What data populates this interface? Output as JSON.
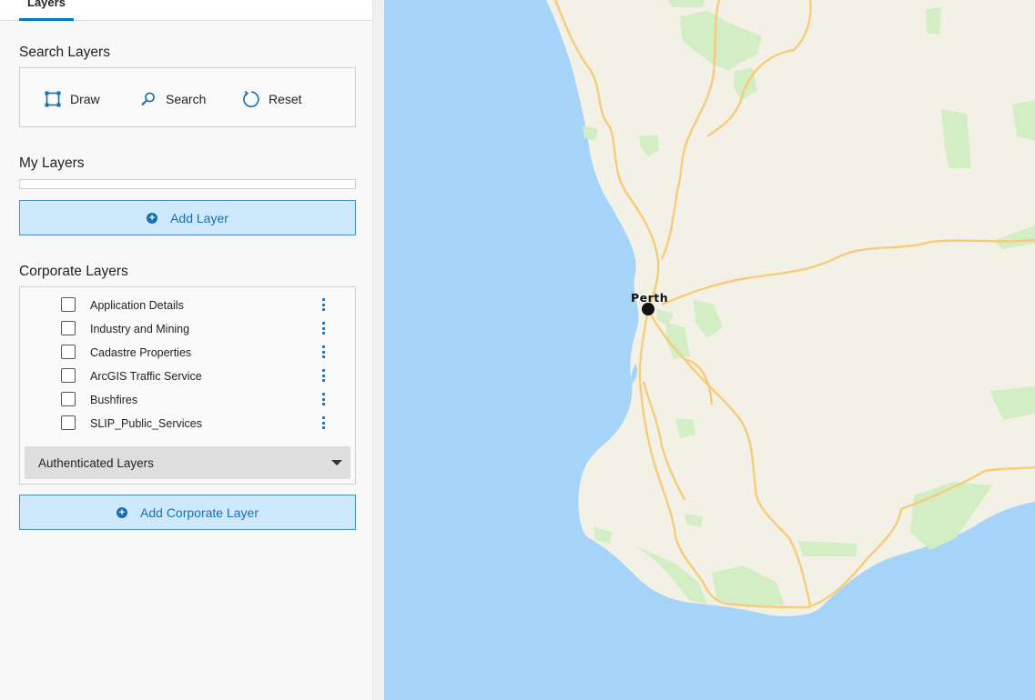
{
  "tabs": {
    "active_label": "Layers"
  },
  "search_layers": {
    "title": "Search Layers",
    "tools": [
      {
        "label": "Draw",
        "icon": "draw-rectangle-icon"
      },
      {
        "label": "Search",
        "icon": "search-icon"
      },
      {
        "label": "Reset",
        "icon": "reset-icon"
      }
    ]
  },
  "my_layers": {
    "title": "My Layers",
    "add_button_label": "Add Layer"
  },
  "corporate_layers": {
    "title": "Corporate Layers",
    "items": [
      {
        "label": "Application Details",
        "checked": false
      },
      {
        "label": "Industry and Mining",
        "checked": false
      },
      {
        "label": "Cadastre Properties",
        "checked": false
      },
      {
        "label": "ArcGIS Traffic Service",
        "checked": false
      },
      {
        "label": "Bushfires",
        "checked": false
      },
      {
        "label": "SLIP_Public_Services",
        "checked": false
      }
    ],
    "group_label": "Authenticated Layers",
    "add_button_label": "Add Corporate Layer"
  },
  "map": {
    "city_label": "Perth",
    "colors": {
      "water": "#a5d4f8",
      "land": "#f3f0e6",
      "park": "#d3edc4",
      "road": "#f6cc7a"
    }
  }
}
